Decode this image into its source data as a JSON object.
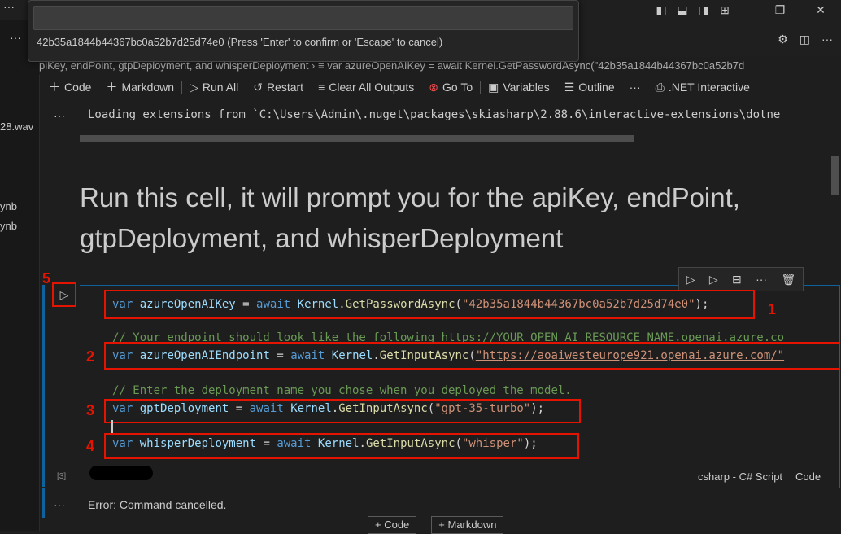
{
  "title_bar": {
    "menu_icon": "ellipsis-icon"
  },
  "quick_input": {
    "value": "",
    "message": "42b35a1844b44367bc0a52b7d25d74e0 (Press 'Enter' to confirm or 'Escape' to cancel)"
  },
  "sidebar": {
    "items": [
      "28.wav",
      "ynb",
      "ynb"
    ],
    "more": "···"
  },
  "breadcrumb": {
    "text": "piKey, endPoint, gtpDeployment, and whisperDeployment  ›  ≡ var azureOpenAIKey = await Kernel.GetPasswordAsync(\"42b35a1844b44367bc0a52b7d"
  },
  "toolbar": {
    "code": "Code",
    "markdown": "Markdown",
    "run_all": "Run All",
    "restart": "Restart",
    "clear_outputs": "Clear All Outputs",
    "go_to": "Go To",
    "variables": "Variables",
    "outline": "Outline",
    "more": "···",
    "kernel": ".NET Interactive"
  },
  "output": {
    "ellipsis": "···",
    "text": "Loading extensions from `C:\\Users\\Admin\\.nuget\\packages\\skiasharp\\2.88.6\\interactive-extensions\\dotne"
  },
  "markdown_cell": {
    "heading": "Run this cell, it will prompt you for the apiKey, endPoint, gtpDeployment, and whisperDeployment"
  },
  "code_cell": {
    "lines": {
      "l1": {
        "kw": "var",
        "id": "azureOpenAIKey",
        "op": " = ",
        "aw": "await",
        "obj": "Kernel",
        "fn": "GetPasswordAsync",
        "str": "\"42b35a1844b44367bc0a52b7d25d74e0\"",
        "end": ");"
      },
      "c1": "// Your endpoint should look like the following https://YOUR_OPEN_AI_RESOURCE_NAME.openai.azure.co",
      "l2": {
        "kw": "var",
        "id": "azureOpenAIEndpoint",
        "op": " = ",
        "aw": "await",
        "obj": "Kernel",
        "fn": "GetInputAsync",
        "str": "\"https://aoaiwesteurope921.openai.azure.com/\"",
        "end": ""
      },
      "c2": "// Enter the deployment name you chose when you deployed the model.",
      "l3": {
        "kw": "var",
        "id": "gptDeployment",
        "op": " = ",
        "aw": "await",
        "obj": "Kernel",
        "fn": "GetInputAsync",
        "str": "\"gpt-35-turbo\"",
        "end": ");"
      },
      "l4": {
        "kw": "var",
        "id": "whisperDeployment",
        "op": " = ",
        "aw": "await",
        "obj": "Kernel",
        "fn": "GetInputAsync",
        "str": "\"whisper\"",
        "end": ");"
      }
    },
    "execution_count": "[3]",
    "language": "csharp - C# Script",
    "code_label": "Code",
    "annotations": [
      "1",
      "2",
      "3",
      "4",
      "5"
    ]
  },
  "error_output": {
    "text": "Error: Command cancelled."
  },
  "add_cell": {
    "code": "+ Code",
    "markdown": "+ Markdown"
  },
  "colors": {
    "accent": "#0e639c",
    "annotation_red": "#e51400"
  }
}
